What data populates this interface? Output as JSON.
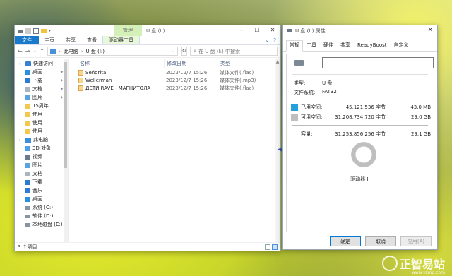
{
  "explorer": {
    "title": "U 盘 (I:)",
    "ctx_tab": "管理",
    "ribbon": {
      "tabs": [
        "文件",
        "主页",
        "共享",
        "查看",
        "驱动器工具"
      ]
    },
    "address": {
      "parts": [
        "此电脑",
        "U 盘 (I:)"
      ],
      "search_placeholder": "在 U 盘 (I:) 中搜索"
    },
    "nav_items": [
      {
        "label": "快速访问",
        "icon": "star-icon",
        "level": 0
      },
      {
        "label": "桌面",
        "icon": "desktop-icon",
        "level": 1,
        "pinned": true
      },
      {
        "label": "下载",
        "icon": "download-icon",
        "level": 1,
        "pinned": true
      },
      {
        "label": "文档",
        "icon": "document-icon",
        "level": 1,
        "pinned": true
      },
      {
        "label": "图片",
        "icon": "picture-icon",
        "level": 1,
        "pinned": true
      },
      {
        "label": "15周年",
        "icon": "folder-icon",
        "level": 1
      },
      {
        "label": "使用",
        "icon": "folder-icon",
        "level": 1
      },
      {
        "label": "使用",
        "icon": "folder-icon",
        "level": 1
      },
      {
        "label": "使用",
        "icon": "folder-icon",
        "level": 1
      },
      {
        "label": "此电脑",
        "icon": "pc-icon",
        "level": 0
      },
      {
        "label": "3D 对象",
        "icon": "3d-object-icon",
        "level": 1
      },
      {
        "label": "视频",
        "icon": "video-icon",
        "level": 1
      },
      {
        "label": "图片",
        "icon": "picture-icon",
        "level": 1
      },
      {
        "label": "文档",
        "icon": "document-icon",
        "level": 1
      },
      {
        "label": "下载",
        "icon": "download-icon",
        "level": 1
      },
      {
        "label": "音乐",
        "icon": "music-icon",
        "level": 1
      },
      {
        "label": "桌面",
        "icon": "desktop-icon",
        "level": 1
      },
      {
        "label": "系统 (C:)",
        "icon": "drive-icon",
        "level": 1
      },
      {
        "label": "软件 (D:)",
        "icon": "drive-icon",
        "level": 1
      },
      {
        "label": "本地磁盘 (E:)",
        "icon": "drive-icon",
        "level": 1
      }
    ],
    "columns": {
      "name": "名称",
      "date": "修改日期",
      "type": "类型"
    },
    "files": [
      {
        "name": "Señorita",
        "date": "2023/12/7 15:26",
        "type": "媒体文件(.flac)"
      },
      {
        "name": "Wellerman",
        "date": "2023/12/7 15:26",
        "type": "媒体文件(.mp3)"
      },
      {
        "name": "ДЕТИ RAVE - МАГНИТОЛА",
        "date": "2023/12/7 15:26",
        "type": "媒体文件(.flac)"
      }
    ],
    "status": "3 个项目"
  },
  "props": {
    "title": "U 盘 (I:) 属性",
    "tabs": [
      "常规",
      "工具",
      "硬件",
      "共享",
      "ReadyBoost",
      "自定义"
    ],
    "type_label": "类型:",
    "type_value": "U 盘",
    "fs_label": "文件系统:",
    "fs_value": "FAT32",
    "used": {
      "label": "已用空间:",
      "bytes": "45,121,536 字节",
      "human": "43.0 MB",
      "color": "#26a0da"
    },
    "free": {
      "label": "可用空间:",
      "bytes": "31,208,734,720 字节",
      "human": "29.0 GB",
      "color": "#bfbfbf"
    },
    "capacity": {
      "label": "容量:",
      "bytes": "31,253,856,256 字节",
      "human": "29.1 GB"
    },
    "used_fraction": 0.0014,
    "drive_label": "驱动器 I:",
    "buttons": {
      "ok": "确定",
      "cancel": "取消",
      "apply": "应用(A)"
    }
  },
  "watermark": {
    "name": "正智易站",
    "url": "www.yzmg.com"
  }
}
